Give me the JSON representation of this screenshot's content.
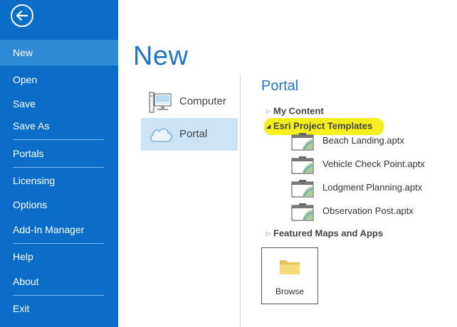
{
  "sidebar": {
    "items": [
      {
        "id": "new",
        "label": "New"
      },
      {
        "id": "open",
        "label": "Open"
      },
      {
        "id": "save",
        "label": "Save"
      },
      {
        "id": "save-as",
        "label": "Save As"
      },
      {
        "id": "portals",
        "label": "Portals"
      },
      {
        "id": "licensing",
        "label": "Licensing"
      },
      {
        "id": "options",
        "label": "Options"
      },
      {
        "id": "add-in-manager",
        "label": "Add-In Manager"
      },
      {
        "id": "help",
        "label": "Help"
      },
      {
        "id": "about",
        "label": "About"
      },
      {
        "id": "exit",
        "label": "Exit"
      }
    ],
    "active": "New",
    "bg_color": "#0a6ec9",
    "active_color": "#2f8ad8"
  },
  "page": {
    "title": "New"
  },
  "locations": {
    "computer": "Computer",
    "portal": "Portal",
    "selected": "Portal"
  },
  "portal": {
    "title": "Portal",
    "tree": {
      "my_content": "My Content",
      "esri_templates": "Esri Project Templates",
      "featured": "Featured Maps and Apps"
    },
    "files": [
      "Beach Landing.aptx",
      "Vehicle Check Point.aptx",
      "Lodgment Planning.aptx",
      "Observation Post.aptx"
    ],
    "highlight_color": "#f7ef1d"
  },
  "browse": {
    "label": "Browse"
  }
}
